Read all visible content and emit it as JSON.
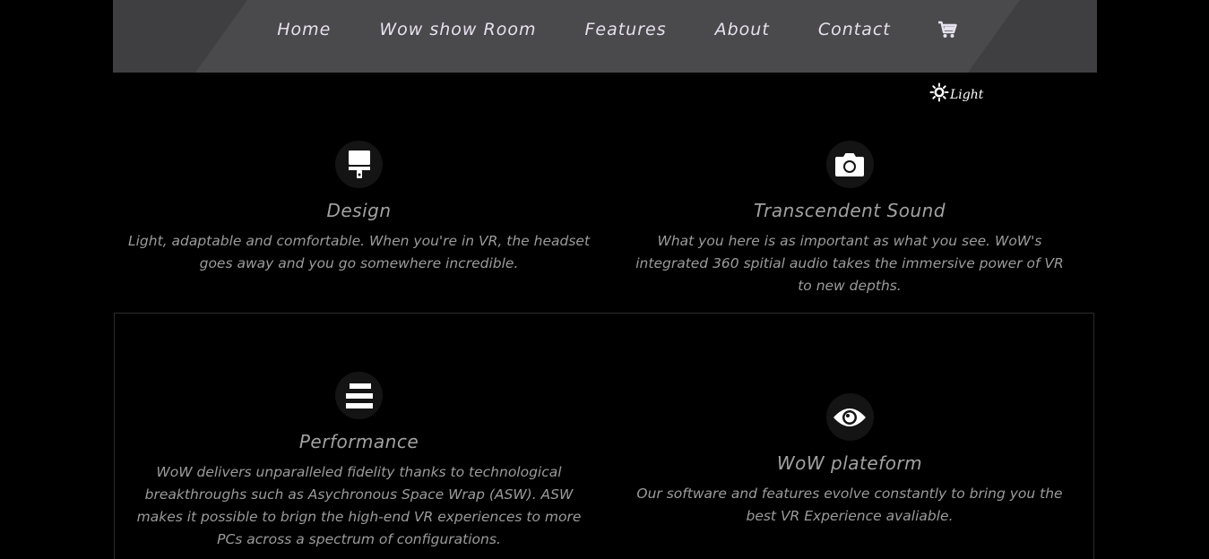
{
  "nav": {
    "links": [
      "Home",
      "Wow show Room",
      "Features",
      "About",
      "Contact"
    ],
    "cart_icon": "shopping-cart-icon"
  },
  "theme_toggle": {
    "icon": "sun-icon",
    "label": "Light"
  },
  "features": [
    {
      "icon": "brush-icon",
      "title": "Design",
      "text": "Light, adaptable and comfortable. When you're in VR, the headset goes away and you go somewhere incredible."
    },
    {
      "icon": "camera-icon",
      "title": "Transcendent Sound",
      "text": "What you here is as important as what you see. WoW's integrated 360 spitial audio takes the immersive power of VR to new depths."
    },
    {
      "icon": "bars-icon",
      "title": "Performance",
      "text": "WoW delivers unparalleled fidelity thanks to technological breakthroughs such as Asychronous Space Wrap (ASW). ASW makes it possible to brign the high-end VR experiences to more PCs across a spectrum of configurations."
    },
    {
      "icon": "eye-icon",
      "title": "WoW plateform",
      "text": "Our software and features evolve constantly to bring you the best VR Experience avaliable."
    }
  ],
  "colors": {
    "background": "#000000",
    "navbar": "#3f3e41",
    "navbar_center": "#4a494c",
    "nav_text": "#e6e1ee",
    "heading": "#a2a2a2",
    "body_text": "#9b9b9b",
    "icon_circle": "#141414"
  }
}
